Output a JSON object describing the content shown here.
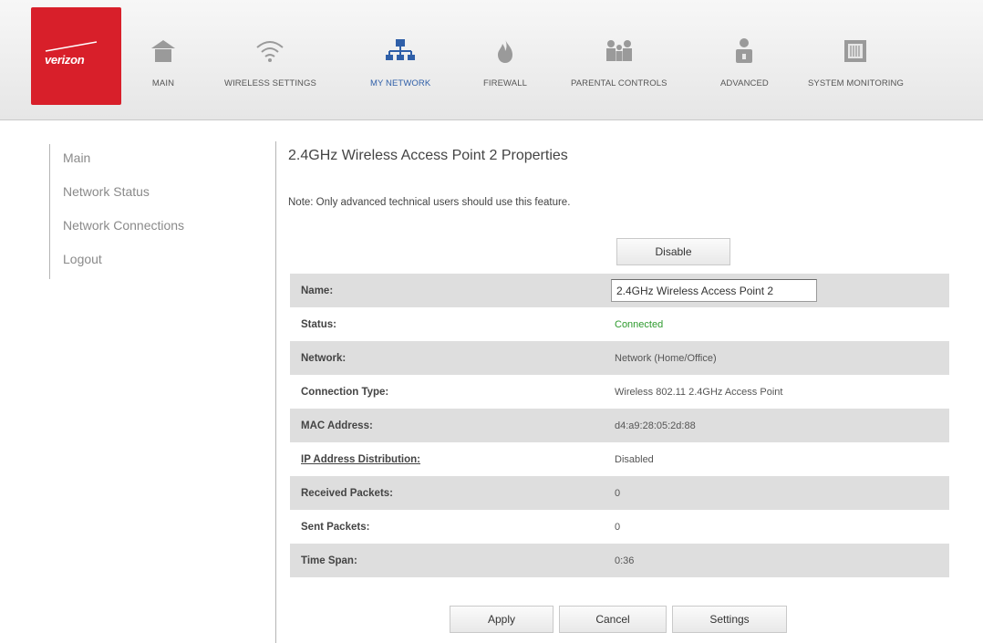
{
  "brand": {
    "logo_text": "verizon",
    "color": "#d81f2a"
  },
  "nav": {
    "items": [
      {
        "label": "MAIN",
        "icon": "home-icon"
      },
      {
        "label": "WIRELESS SETTINGS",
        "icon": "wifi-icon"
      },
      {
        "label": "MY NETWORK",
        "icon": "network-icon",
        "active": true
      },
      {
        "label": "FIREWALL",
        "icon": "flame-icon"
      },
      {
        "label": "PARENTAL CONTROLS",
        "icon": "family-icon"
      },
      {
        "label": "ADVANCED",
        "icon": "person-lock-icon"
      },
      {
        "label": "SYSTEM MONITORING",
        "icon": "monitor-icon"
      }
    ],
    "active_color": "#2f5fa8"
  },
  "sidebar": {
    "items": [
      {
        "label": "Main"
      },
      {
        "label": "Network Status"
      },
      {
        "label": "Network Connections"
      },
      {
        "label": "Logout"
      }
    ]
  },
  "page": {
    "title": "2.4GHz Wireless Access Point 2 Properties",
    "note": "Note: Only advanced technical users should use this feature.",
    "disable_label": "Disable"
  },
  "properties": {
    "name": {
      "label": "Name:",
      "value": "2.4GHz Wireless Access Point 2"
    },
    "status": {
      "label": "Status:",
      "value": "Connected"
    },
    "network": {
      "label": "Network:",
      "value": "Network (Home/Office)"
    },
    "connection_type": {
      "label": "Connection Type:",
      "value": "Wireless 802.11 2.4GHz Access Point"
    },
    "mac_address": {
      "label": "MAC Address:",
      "value": "d4:a9:28:05:2d:88"
    },
    "ip_distribution": {
      "label": "IP Address Distribution:",
      "value": "Disabled"
    },
    "received_packets": {
      "label": "Received Packets:",
      "value": "0"
    },
    "sent_packets": {
      "label": "Sent Packets:",
      "value": "0"
    },
    "time_span": {
      "label": "Time Span:",
      "value": "0:36"
    }
  },
  "actions": {
    "apply": "Apply",
    "cancel": "Cancel",
    "settings": "Settings"
  },
  "colors": {
    "status_ok": "#2d9a2d",
    "row_shade": "#dedede"
  }
}
